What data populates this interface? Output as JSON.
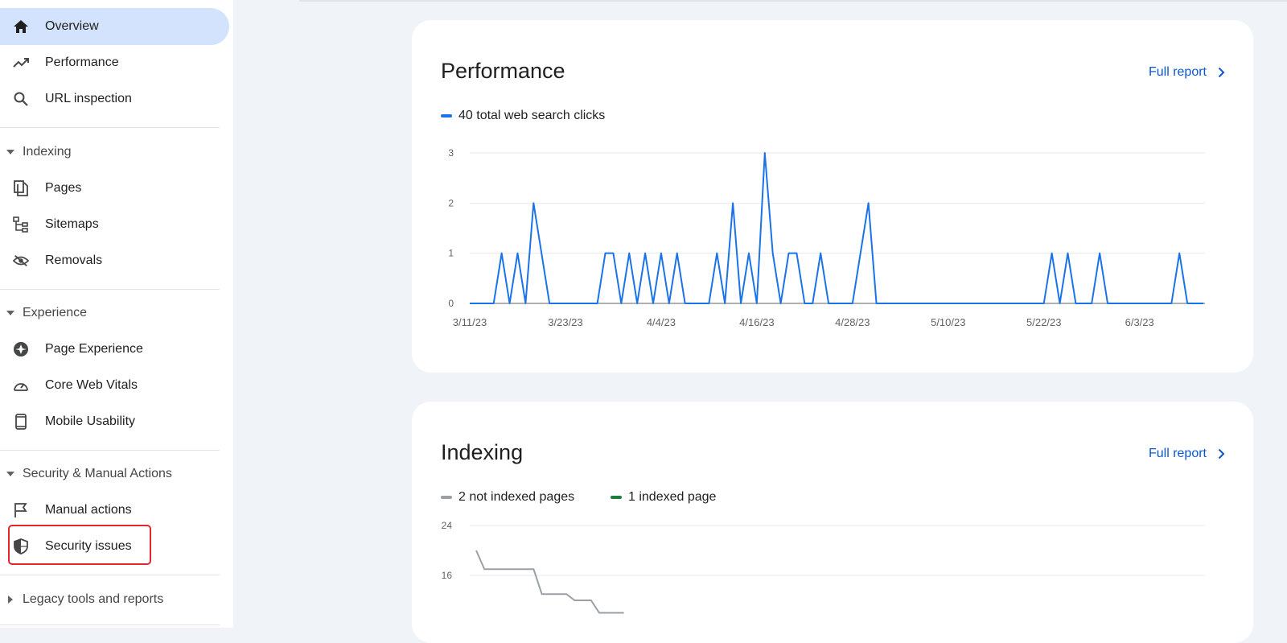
{
  "sidebar": {
    "top_items": [
      {
        "label": "Overview",
        "icon": "home-icon",
        "active": true
      },
      {
        "label": "Performance",
        "icon": "trending-up-icon"
      },
      {
        "label": "URL inspection",
        "icon": "search-icon"
      }
    ],
    "sections": [
      {
        "title": "Indexing",
        "expanded": true,
        "items": [
          {
            "label": "Pages",
            "icon": "pages-icon"
          },
          {
            "label": "Sitemaps",
            "icon": "sitemap-icon"
          },
          {
            "label": "Removals",
            "icon": "eye-off-icon"
          }
        ]
      },
      {
        "title": "Experience",
        "expanded": true,
        "items": [
          {
            "label": "Page Experience",
            "icon": "page-experience-icon"
          },
          {
            "label": "Core Web Vitals",
            "icon": "speedometer-icon"
          },
          {
            "label": "Mobile Usability",
            "icon": "mobile-icon"
          }
        ]
      },
      {
        "title": "Security & Manual Actions",
        "expanded": true,
        "items": [
          {
            "label": "Manual actions",
            "icon": "flag-icon"
          },
          {
            "label": "Security issues",
            "icon": "shield-icon",
            "highlighted": true
          }
        ]
      },
      {
        "title": "Legacy tools and reports",
        "expanded": false,
        "items": []
      }
    ]
  },
  "performance_card": {
    "title": "Performance",
    "full_report_label": "Full report",
    "legend_label": "40 total web search clicks",
    "series_color": "#1a73e8"
  },
  "indexing_card": {
    "title": "Indexing",
    "full_report_label": "Full report",
    "legend": [
      {
        "label": "2 not indexed pages",
        "color": "#9aa0a6"
      },
      {
        "label": "1 indexed page",
        "color": "#188038"
      }
    ]
  },
  "chart_data": [
    {
      "type": "line",
      "title": "",
      "series": [
        {
          "name": "40 total web search clicks",
          "x": [
            "3/11/23",
            "3/12/23",
            "3/13/23",
            "3/14/23",
            "3/15/23",
            "3/16/23",
            "3/17/23",
            "3/18/23",
            "3/19/23",
            "3/20/23",
            "3/21/23",
            "3/22/23",
            "3/23/23",
            "3/24/23",
            "3/25/23",
            "3/26/23",
            "3/27/23",
            "3/28/23",
            "3/29/23",
            "3/30/23",
            "3/31/23",
            "4/1/23",
            "4/2/23",
            "4/3/23",
            "4/4/23",
            "4/5/23",
            "4/6/23",
            "4/7/23",
            "4/8/23",
            "4/9/23",
            "4/10/23",
            "4/11/23",
            "4/12/23",
            "4/13/23",
            "4/14/23",
            "4/15/23",
            "4/16/23",
            "4/17/23",
            "4/18/23",
            "4/19/23",
            "4/20/23",
            "4/21/23",
            "4/22/23",
            "4/23/23",
            "4/24/23",
            "4/25/23",
            "4/26/23",
            "4/27/23",
            "4/28/23",
            "4/29/23",
            "4/30/23",
            "5/1/23",
            "5/2/23",
            "5/3/23",
            "5/4/23",
            "5/5/23",
            "5/6/23",
            "5/7/23",
            "5/8/23",
            "5/9/23",
            "5/10/23",
            "5/11/23",
            "5/12/23",
            "5/13/23",
            "5/14/23",
            "5/15/23",
            "5/16/23",
            "5/17/23",
            "5/18/23",
            "5/19/23",
            "5/20/23",
            "5/21/23",
            "5/22/23",
            "5/23/23",
            "5/24/23",
            "5/25/23",
            "5/26/23",
            "5/27/23",
            "5/28/23",
            "5/29/23",
            "5/30/23",
            "5/31/23",
            "6/1/23",
            "6/2/23",
            "6/3/23",
            "6/4/23",
            "6/5/23",
            "6/6/23",
            "6/7/23",
            "6/8/23",
            "6/9/23",
            "6/10/23",
            "6/11/23"
          ],
          "values": [
            0,
            0,
            0,
            0,
            1,
            0,
            1,
            0,
            2,
            1,
            0,
            0,
            0,
            0,
            0,
            0,
            0,
            1,
            1,
            0,
            1,
            0,
            1,
            0,
            1,
            0,
            1,
            0,
            0,
            0,
            0,
            1,
            0,
            2,
            0,
            1,
            0,
            3,
            1,
            0,
            1,
            1,
            0,
            0,
            1,
            0,
            0,
            0,
            0,
            1,
            2,
            0,
            0,
            0,
            0,
            0,
            0,
            0,
            0,
            0,
            0,
            0,
            0,
            0,
            0,
            0,
            0,
            0,
            0,
            0,
            0,
            0,
            0,
            1,
            0,
            1,
            0,
            0,
            0,
            1,
            0,
            0,
            0,
            0,
            0,
            0,
            0,
            0,
            0,
            1,
            0,
            0,
            0
          ]
        }
      ],
      "x_tick_labels": [
        "3/11/23",
        "3/23/23",
        "4/4/23",
        "4/16/23",
        "4/28/23",
        "5/10/23",
        "5/22/23",
        "6/3/23"
      ],
      "y_ticks": [
        0,
        1,
        2,
        3
      ],
      "ylim": [
        0,
        3
      ],
      "grid": true,
      "legend_placement": "top-left"
    },
    {
      "type": "line",
      "title": "",
      "series": [
        {
          "name": "2 not indexed pages",
          "values": [
            20,
            17,
            17,
            17,
            17,
            17,
            17,
            17,
            13,
            13,
            13,
            13,
            12,
            12,
            12,
            10,
            10,
            10,
            10
          ]
        }
      ],
      "y_ticks": [
        16,
        24
      ],
      "ylim": [
        8,
        24
      ],
      "grid": true,
      "legend_placement": "top-left"
    }
  ]
}
